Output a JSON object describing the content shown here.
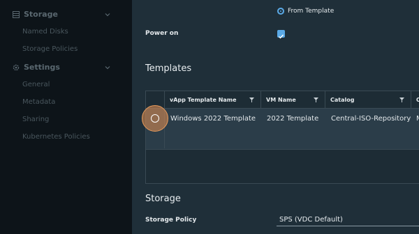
{
  "sidebar": {
    "storage": {
      "label": "Storage",
      "icon": "database-icon",
      "items": [
        "Named Disks",
        "Storage Policies"
      ]
    },
    "settings": {
      "label": "Settings",
      "icon": "gear-icon",
      "items": [
        "General",
        "Metadata",
        "Sharing",
        "Kubernetes Policies"
      ]
    }
  },
  "form": {
    "source_option": "From Template",
    "power_on_label": "Power on",
    "power_on_checked": true
  },
  "templates": {
    "heading": "Templates",
    "columns": [
      "vApp Template Name",
      "VM Name",
      "Catalog",
      "O"
    ],
    "rows": [
      {
        "template": "Windows 2022 Template",
        "vm": "2022 Template",
        "catalog": "Central-ISO-Repository",
        "more": "M"
      }
    ]
  },
  "storage": {
    "heading": "Storage",
    "policy_label": "Storage Policy",
    "policy_value": "SPS (VDC Default)"
  },
  "colors": {
    "accent": "#5aa9e6",
    "highlight": "#e69a5c"
  }
}
